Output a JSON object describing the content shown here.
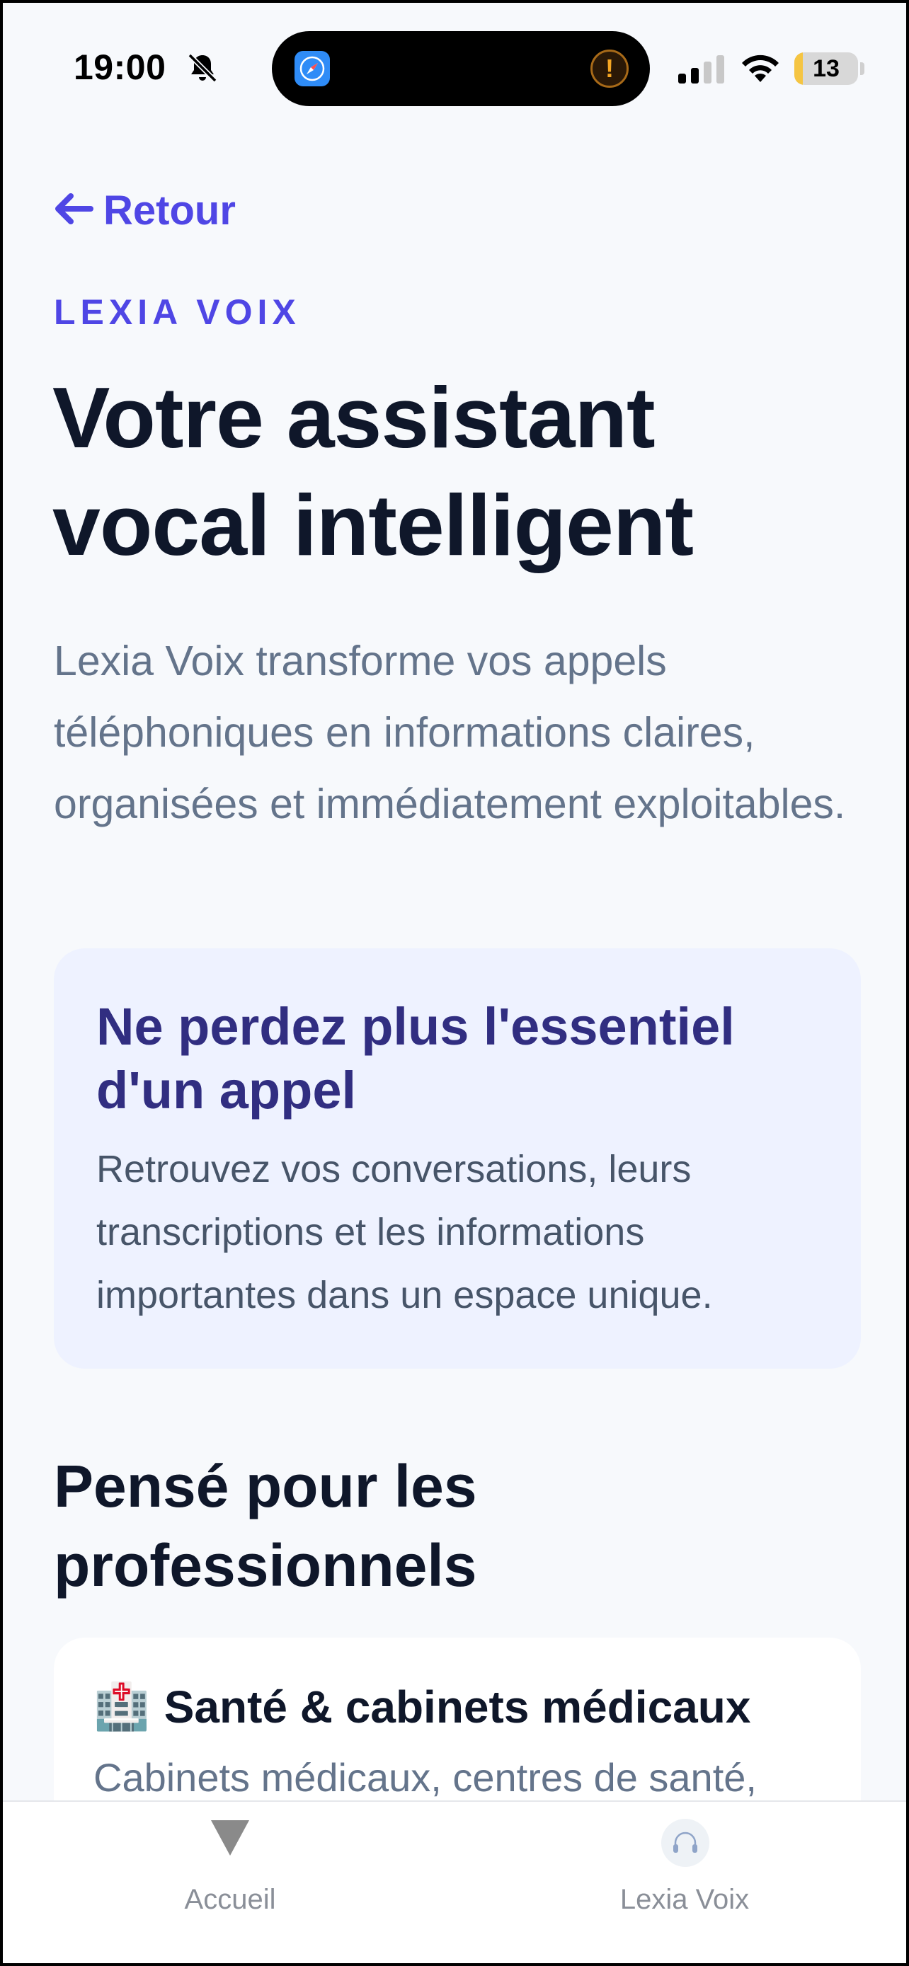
{
  "status_bar": {
    "time": "19:00",
    "battery_level": "13",
    "battery_fraction": 0.13,
    "icons": [
      "bell-slash-icon",
      "compass-icon",
      "warning-icon",
      "cellular-signal-icon",
      "wifi-icon",
      "battery-icon"
    ]
  },
  "nav": {
    "back_label": "Retour",
    "back_icon": "arrow-left-icon"
  },
  "hero": {
    "eyebrow": "LEXIA VOIX",
    "title": "Votre assistant vocal intelligent",
    "description": "Lexia Voix transforme vos appels téléphoniques en informations claires, organisées et immédiatement exploitables."
  },
  "highlight_card": {
    "title": "Ne perdez plus l'essentiel d'un appel",
    "body": "Retrouvez vos conversations, leurs transcriptions et les informations importantes dans un espace unique."
  },
  "professionals": {
    "section_title": "Pensé pour les professionnels",
    "cards": [
      {
        "emoji": "🏥",
        "title": "Santé & cabinets médicaux",
        "description": "Cabinets médicaux, centres de santé,"
      }
    ]
  },
  "tab_bar": {
    "tabs": [
      {
        "label": "Accueil",
        "icon": "triangle-down-icon"
      },
      {
        "label": "Lexia Voix",
        "icon": "headset-icon"
      }
    ]
  },
  "colors": {
    "accent": "#4f46e5",
    "card_title": "#312e81",
    "card_bg": "#eef2ff",
    "text_dark": "#0f172a",
    "text_muted": "#64748b"
  }
}
